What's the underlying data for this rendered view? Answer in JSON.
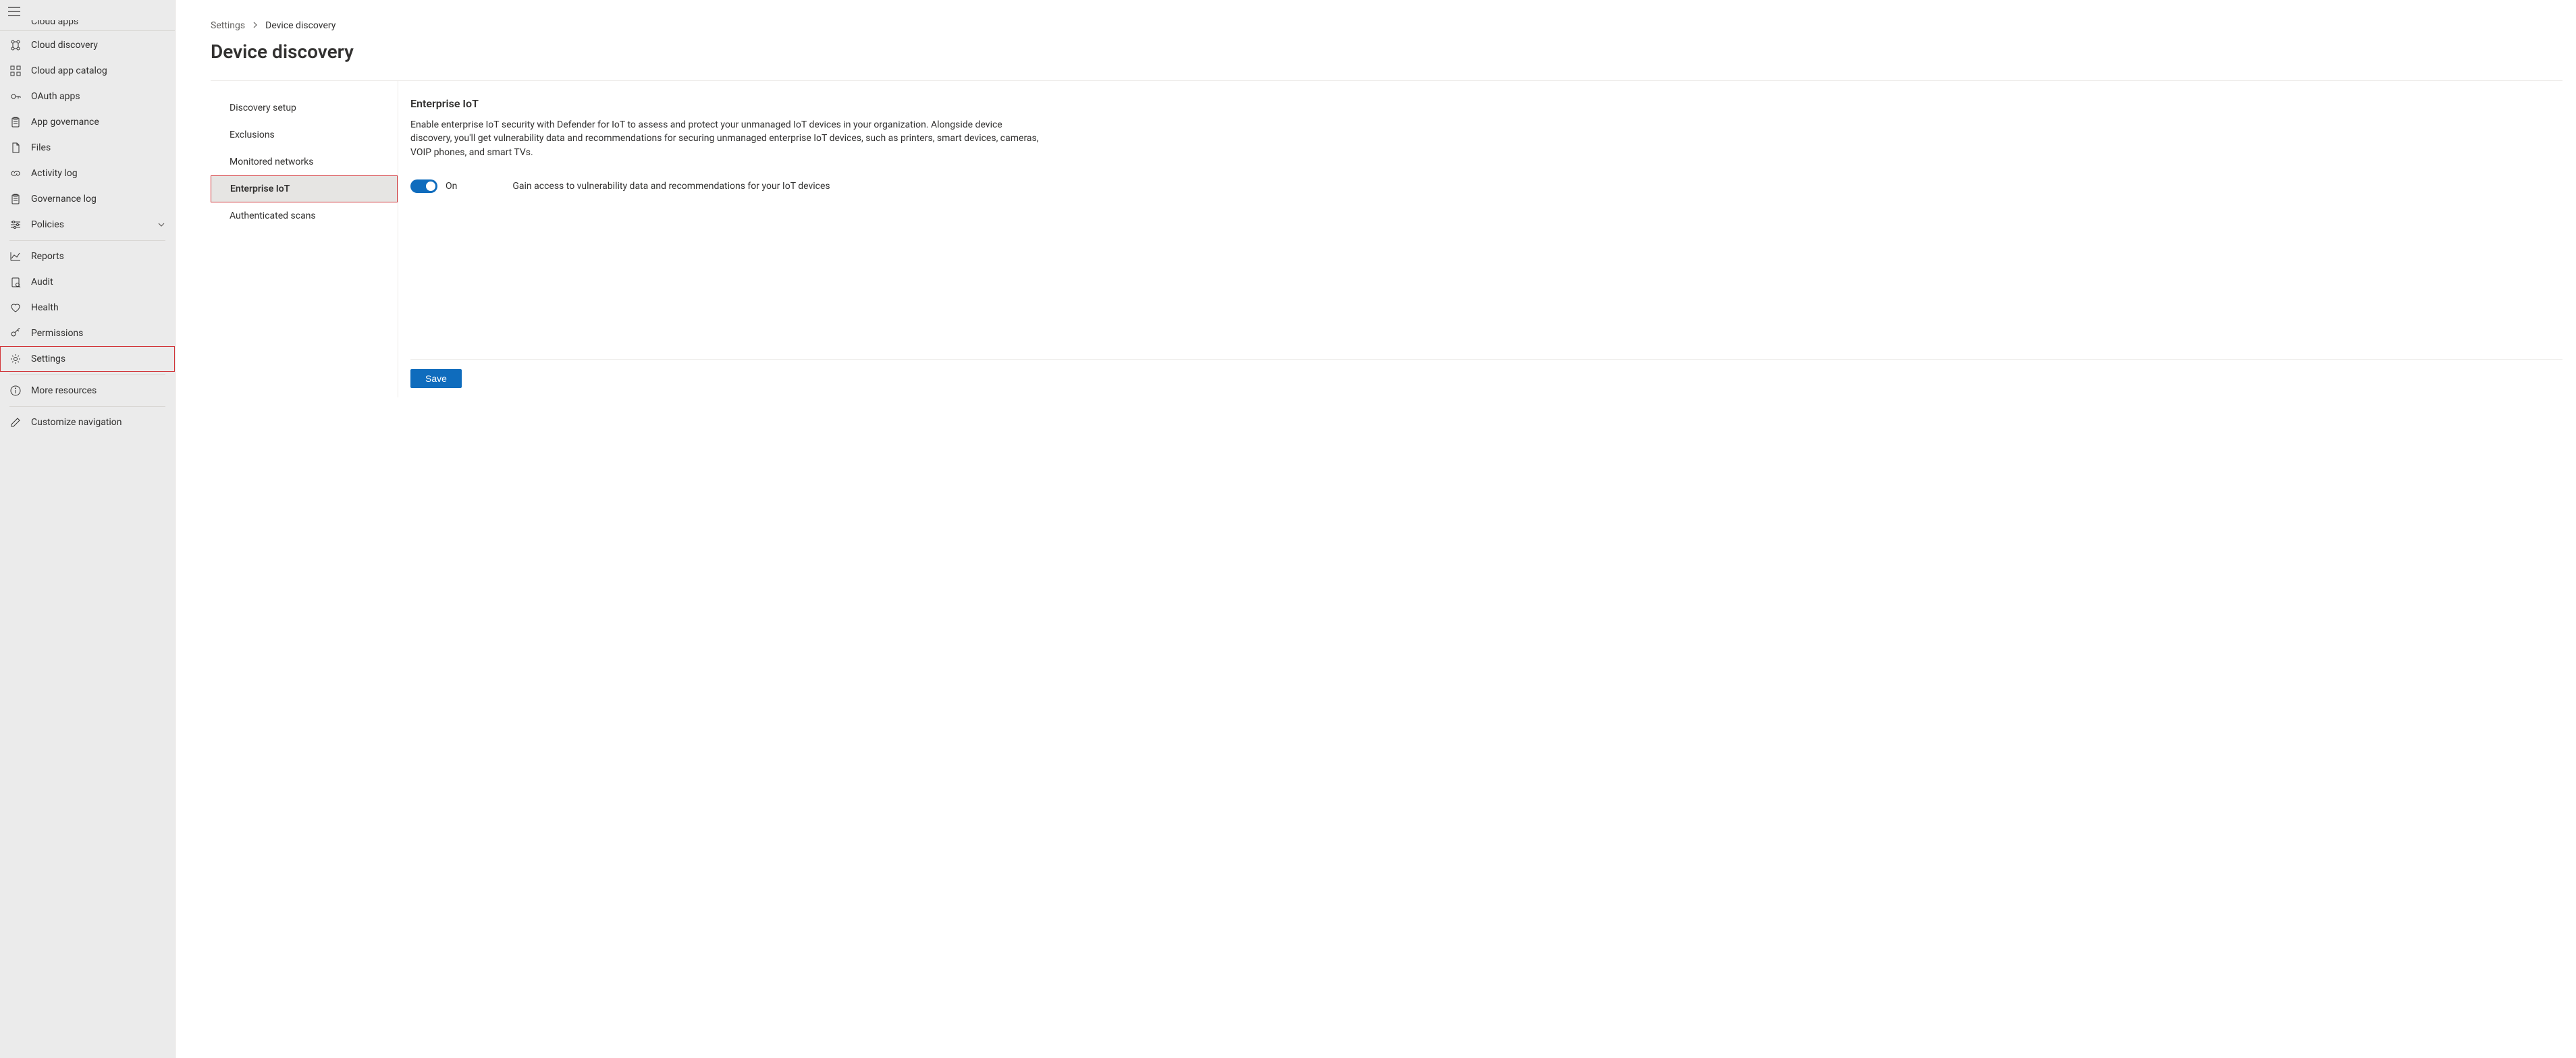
{
  "sidebar": {
    "truncated_top": "Cloud apps",
    "items": [
      {
        "id": "cloud-discovery",
        "label": "Cloud discovery",
        "icon": "org"
      },
      {
        "id": "cloud-app-catalog",
        "label": "Cloud app catalog",
        "icon": "grid"
      },
      {
        "id": "oauth-apps",
        "label": "OAuth apps",
        "icon": "key"
      },
      {
        "id": "app-governance",
        "label": "App governance",
        "icon": "clipboard"
      },
      {
        "id": "files",
        "label": "Files",
        "icon": "doc"
      },
      {
        "id": "activity-log",
        "label": "Activity log",
        "icon": "link"
      },
      {
        "id": "governance-log",
        "label": "Governance log",
        "icon": "clipboard"
      },
      {
        "id": "policies",
        "label": "Policies",
        "icon": "sliders",
        "expandable": true
      }
    ],
    "items2": [
      {
        "id": "reports",
        "label": "Reports",
        "icon": "chart"
      },
      {
        "id": "audit",
        "label": "Audit",
        "icon": "audit"
      },
      {
        "id": "health",
        "label": "Health",
        "icon": "heart"
      },
      {
        "id": "permissions",
        "label": "Permissions",
        "icon": "keyslash"
      },
      {
        "id": "settings",
        "label": "Settings",
        "icon": "gear",
        "highlight": true
      }
    ],
    "items3": [
      {
        "id": "more-resources",
        "label": "More resources",
        "icon": "info"
      }
    ],
    "items4": [
      {
        "id": "customize-navigation",
        "label": "Customize navigation",
        "icon": "pencil"
      }
    ]
  },
  "breadcrumb": {
    "crumbs": [
      "Settings",
      "Device discovery"
    ]
  },
  "page_title": "Device discovery",
  "subnav": {
    "items": [
      {
        "id": "discovery-setup",
        "label": "Discovery setup"
      },
      {
        "id": "exclusions",
        "label": "Exclusions"
      },
      {
        "id": "monitored-networks",
        "label": "Monitored networks"
      },
      {
        "id": "enterprise-iot",
        "label": "Enterprise IoT",
        "selected": true,
        "highlight": true
      },
      {
        "id": "authenticated-scans",
        "label": "Authenticated scans"
      }
    ]
  },
  "detail": {
    "heading": "Enterprise IoT",
    "description": "Enable enterprise IoT security with Defender for IoT to assess and protect your unmanaged IoT devices in your organization. Alongside device discovery, you'll get vulnerability data and recommendations for securing unmanaged enterprise IoT devices, such as printers, smart devices, cameras, VOIP phones, and smart TVs.",
    "toggle_on": true,
    "toggle_label": "On",
    "toggle_hint": "Gain access to vulnerability data and recommendations for your IoT devices",
    "save_label": "Save"
  },
  "colors": {
    "accent": "#0f6cbd",
    "highlight": "#d13438"
  }
}
